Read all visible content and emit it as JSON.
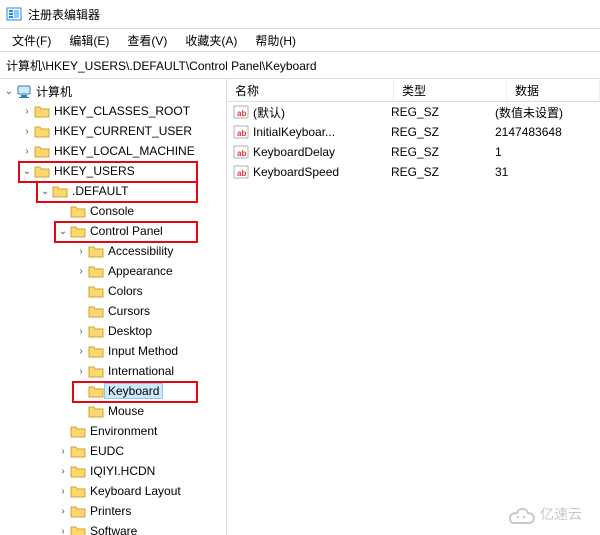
{
  "window": {
    "title": "注册表编辑器"
  },
  "menu": {
    "file": "文件(F)",
    "edit": "编辑(E)",
    "view": "查看(V)",
    "fav": "收藏夹(A)",
    "help": "帮助(H)"
  },
  "address": "计算机\\HKEY_USERS\\.DEFAULT\\Control Panel\\Keyboard",
  "columns": {
    "name": "名称",
    "type": "类型",
    "data": "数据"
  },
  "tree": {
    "root": "计算机",
    "hives": {
      "hkcr": "HKEY_CLASSES_ROOT",
      "hkcu": "HKEY_CURRENT_USER",
      "hklm": "HKEY_LOCAL_MACHINE",
      "hku": "HKEY_USERS"
    },
    "default": ".DEFAULT",
    "default_children": {
      "console": "Console",
      "cpl": "Control Panel",
      "env": "Environment",
      "eudc": "EUDC",
      "iqiyi": "IQIYI.HCDN",
      "kbdlayout": "Keyboard Layout",
      "printers": "Printers",
      "software": "Software"
    },
    "cpl_children": {
      "accessibility": "Accessibility",
      "appearance": "Appearance",
      "colors": "Colors",
      "cursors": "Cursors",
      "desktop": "Desktop",
      "inputmethod": "Input Method",
      "international": "International",
      "keyboard": "Keyboard",
      "mouse": "Mouse"
    }
  },
  "values": [
    {
      "name": "(默认)",
      "type": "REG_SZ",
      "data": "(数值未设置)"
    },
    {
      "name": "InitialKeyboar...",
      "type": "REG_SZ",
      "data": "2147483648"
    },
    {
      "name": "KeyboardDelay",
      "type": "REG_SZ",
      "data": "1"
    },
    {
      "name": "KeyboardSpeed",
      "type": "REG_SZ",
      "data": "31"
    }
  ],
  "watermark": "亿速云"
}
